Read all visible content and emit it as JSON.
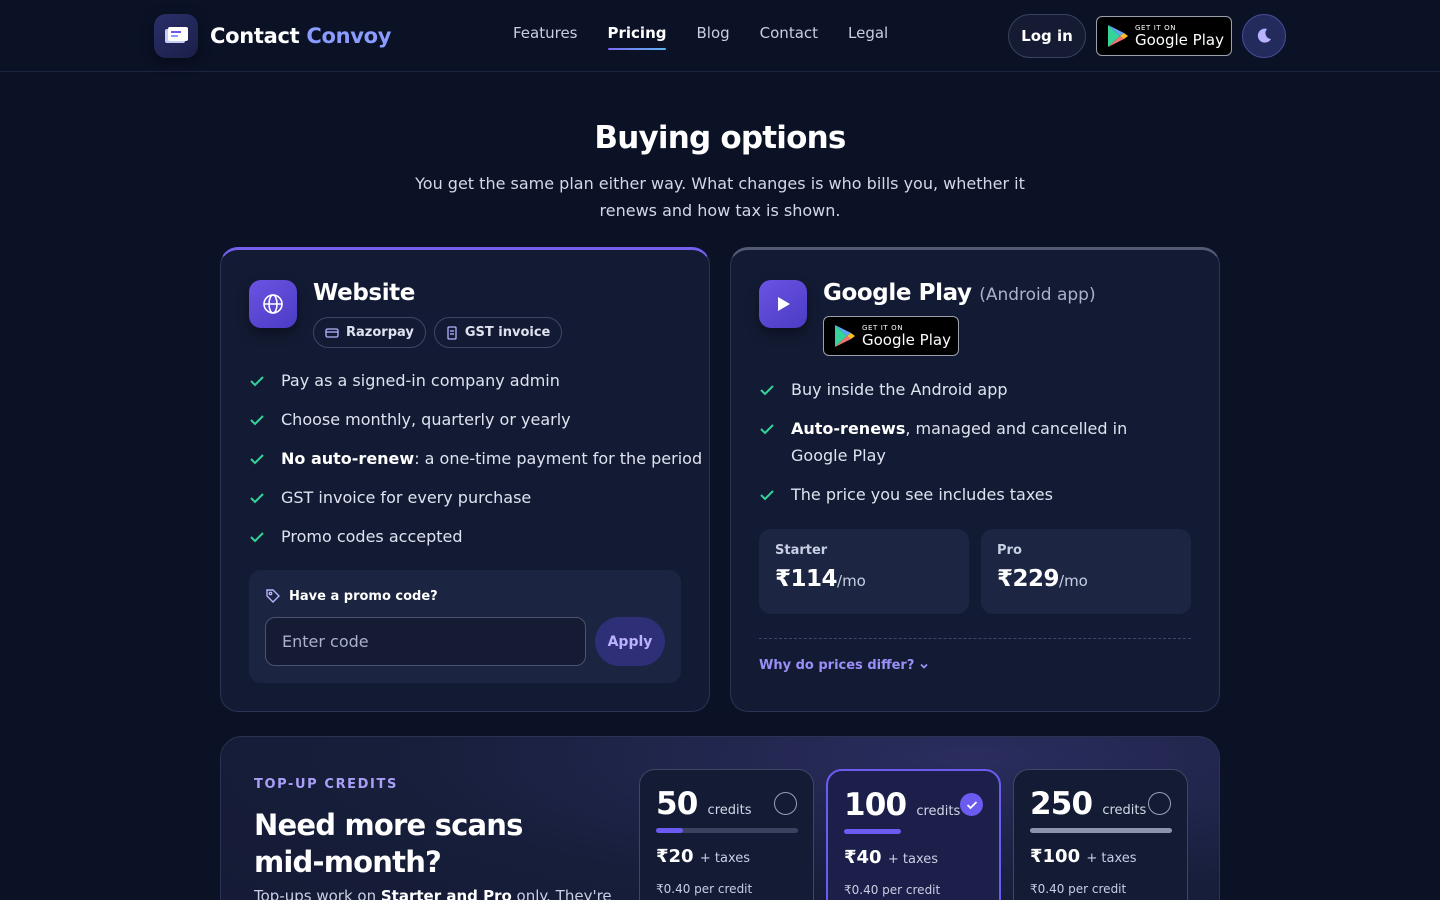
{
  "brand": {
    "name_part1": "Contact",
    "name_part2": "Convoy"
  },
  "nav": {
    "links": [
      "Features",
      "Pricing",
      "Blog",
      "Contact",
      "Legal"
    ],
    "active": "Pricing",
    "login_label": "Log in",
    "google_play_small": "GET IT ON",
    "google_play_big": "Google Play",
    "theme_icon": "moon-icon"
  },
  "header": {
    "title": "Buying options",
    "subtitle": "You get the same plan either way. What changes is who bills you, whether it renews and how tax is shown."
  },
  "website_card": {
    "title": "Website",
    "tags": [
      "Razorpay",
      "GST invoice"
    ],
    "features": [
      {
        "bold": "",
        "text": "Pay as a signed-in company admin"
      },
      {
        "bold": "",
        "text": "Choose monthly, quarterly or yearly"
      },
      {
        "bold": "No auto-renew",
        "text": ": a one-time payment for the period"
      },
      {
        "bold": "",
        "text": "GST invoice for every purchase"
      },
      {
        "bold": "",
        "text": "Promo codes accepted"
      }
    ],
    "promo": {
      "heading": "Have a promo code?",
      "placeholder": "Enter code",
      "apply_label": "Apply"
    }
  },
  "gplay_card": {
    "title": "Google Play",
    "title_suffix": "(Android app)",
    "badge_small": "GET IT ON",
    "badge_big": "Google Play",
    "features": [
      {
        "bold": "",
        "text": "Buy inside the Android app"
      },
      {
        "bold": "Auto-renews",
        "text": ", managed and cancelled in Google Play"
      },
      {
        "bold": "",
        "text": "The price you see includes taxes"
      }
    ],
    "plans": [
      {
        "name": "Starter",
        "price": "₹114",
        "per": "/mo"
      },
      {
        "name": "Pro",
        "price": "₹229",
        "per": "/mo"
      }
    ],
    "why_label": "Why do prices differ?"
  },
  "topup": {
    "eyebrow": "TOP-UP CREDITS",
    "title": "Need more scans mid-month?",
    "desc_prefix": "Top-ups work on ",
    "desc_bold": "Starter and Pro",
    "desc_suffix": " only. They're",
    "packs": [
      {
        "qty": "50",
        "unit": "credits",
        "price": "₹20",
        "tax": "+ taxes",
        "per_credit": "₹0.40 per credit",
        "selected": false,
        "fill": 0.19
      },
      {
        "qty": "100",
        "unit": "credits",
        "price": "₹40",
        "tax": "+ taxes",
        "per_credit": "₹0.40 per credit",
        "selected": true,
        "fill": 0.4
      },
      {
        "qty": "250",
        "unit": "credits",
        "price": "₹100",
        "tax": "+ taxes",
        "per_credit": "₹0.40 per credit",
        "selected": false,
        "fill": 1.0
      }
    ]
  },
  "colors": {
    "accent": "#6b5bf0",
    "check": "#34d399",
    "background": "#0b1226"
  }
}
